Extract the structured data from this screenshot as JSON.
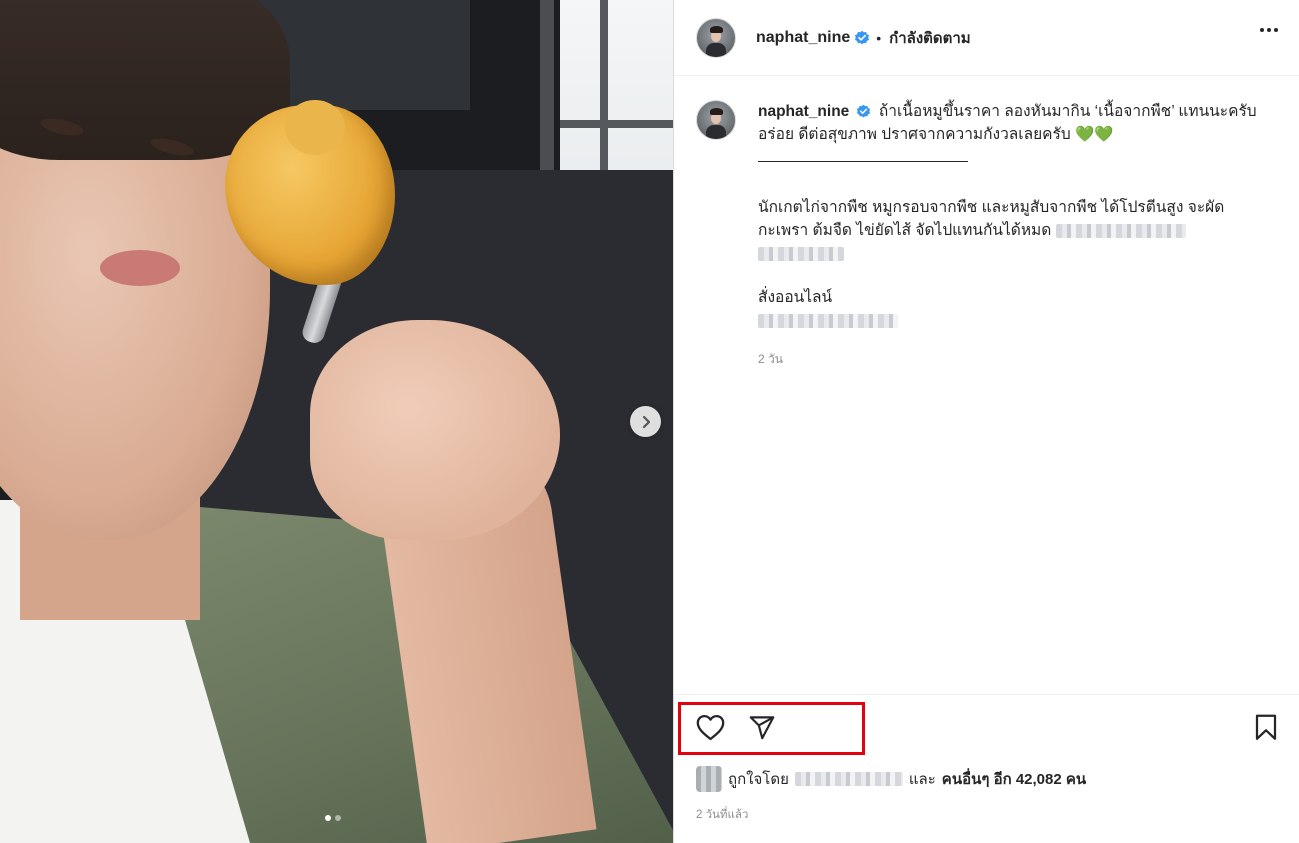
{
  "header": {
    "username": "naphat_nine",
    "separator": "•",
    "follow_status": "กำลังติดตาม"
  },
  "caption": {
    "username": "naphat_nine",
    "line1": "ถ้าเนื้อหมูขึ้นราคา ลองหันมากิน ‘เนื้อจากพืช’ แทนนะครับ",
    "line2": "อร่อย ดีต่อสุขภาพ ปราศจากความกังวลเลยครับ",
    "hearts": "💚💚",
    "para1_line1": "นักเกตไก่จากพืช หมูกรอบจากพืช และหมูสับจากพืช ได้โปรตีนสูง จะผัด",
    "para1_line2": "กะเพรา ต้มจืด ไข่ยัดไส้ จัดไปแทนกันได้หมด",
    "order_label": "สั่งออนไลน์",
    "age": "2 วัน"
  },
  "likes": {
    "prefix": "ถูกใจโดย",
    "and": "และ",
    "others": "คนอื่นๆ อีก 42,082 คน"
  },
  "posted": "2 วันที่แล้ว",
  "icons": {
    "like": "heart-icon",
    "share": "paper-plane-icon",
    "save": "bookmark-icon",
    "next": "chevron-right-icon",
    "verified": "verified-badge-icon",
    "more": "more-options-icon"
  },
  "colors": {
    "verified": "#3897f0",
    "highlight": "#e3000f",
    "hearts": "#1db33a",
    "secondary_text": "#8e8e8e"
  },
  "carousel": {
    "current": 1,
    "total": 2
  }
}
